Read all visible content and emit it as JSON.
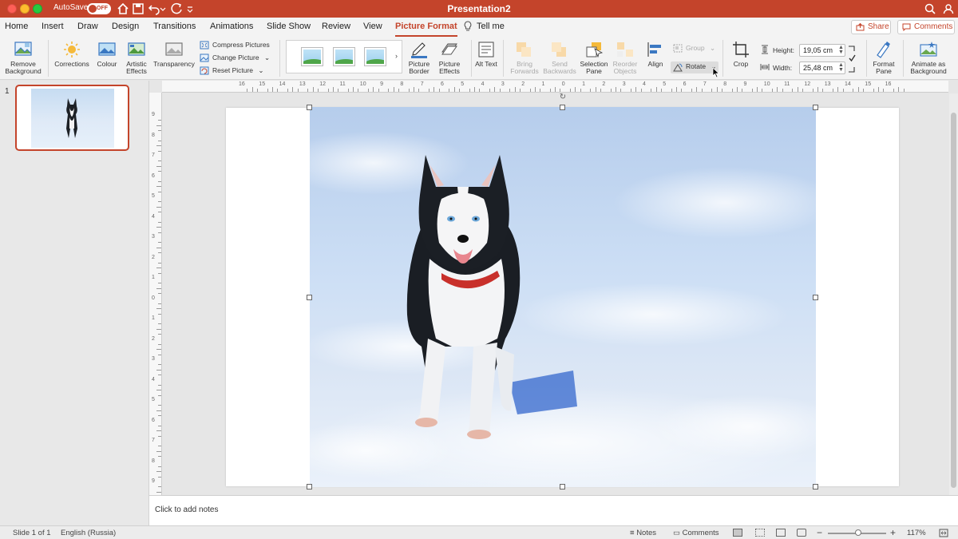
{
  "titlebar": {
    "autosave_label": "AutoSave",
    "autosave_state": "OFF",
    "document_title": "Presentation2"
  },
  "tabs": [
    {
      "label": "Home"
    },
    {
      "label": "Insert"
    },
    {
      "label": "Draw"
    },
    {
      "label": "Design"
    },
    {
      "label": "Transitions"
    },
    {
      "label": "Animations"
    },
    {
      "label": "Slide Show"
    },
    {
      "label": "Review"
    },
    {
      "label": "View"
    },
    {
      "label": "Picture Format"
    },
    {
      "label": "Tell me"
    }
  ],
  "top_right": {
    "share_label": "Share",
    "comments_label": "Comments"
  },
  "ribbon": {
    "remove_background": "Remove Background",
    "corrections": "Corrections",
    "colour": "Colour",
    "artistic_effects": "Artistic Effects",
    "transparency": "Transparency",
    "compress_pictures": "Compress Pictures",
    "change_picture": "Change Picture",
    "reset_picture": "Reset Picture",
    "picture_border": "Picture Border",
    "picture_effects": "Picture Effects",
    "alt_text": "Alt Text",
    "bring_forwards": "Bring Forwards",
    "send_backwards": "Send Backwards",
    "selection_pane": "Selection Pane",
    "reorder_objects": "Reorder Objects",
    "align": "Align",
    "group": "Group",
    "rotate": "Rotate",
    "crop": "Crop",
    "height_label": "Height:",
    "height_value": "19,05 cm",
    "width_label": "Width:",
    "width_value": "25,48 cm",
    "format_pane": "Format Pane",
    "animate_as_background": "Animate as Background"
  },
  "slides": {
    "current_number": "1"
  },
  "ruler_h": [
    "16",
    "15",
    "14",
    "13",
    "12",
    "11",
    "10",
    "9",
    "8",
    "7",
    "6",
    "5",
    "4",
    "3",
    "2",
    "1",
    "0",
    "1",
    "2",
    "3",
    "4",
    "5",
    "6",
    "7",
    "8",
    "9",
    "10",
    "11",
    "12",
    "13",
    "14",
    "15",
    "16"
  ],
  "ruler_v": [
    "9",
    "8",
    "7",
    "6",
    "5",
    "4",
    "3",
    "2",
    "1",
    "0",
    "1",
    "2",
    "3",
    "4",
    "5",
    "6",
    "7",
    "8",
    "9"
  ],
  "notes": {
    "placeholder": "Click to add notes"
  },
  "status": {
    "slide_of": "Slide 1 of 1",
    "language": "English (Russia)",
    "notes_label": "Notes",
    "comments_label": "Comments",
    "zoom": "117%",
    "zoom_level_percent": 117
  },
  "colors": {
    "accent": "#c4442b",
    "ribbon_bg": "#f3f3f3"
  }
}
